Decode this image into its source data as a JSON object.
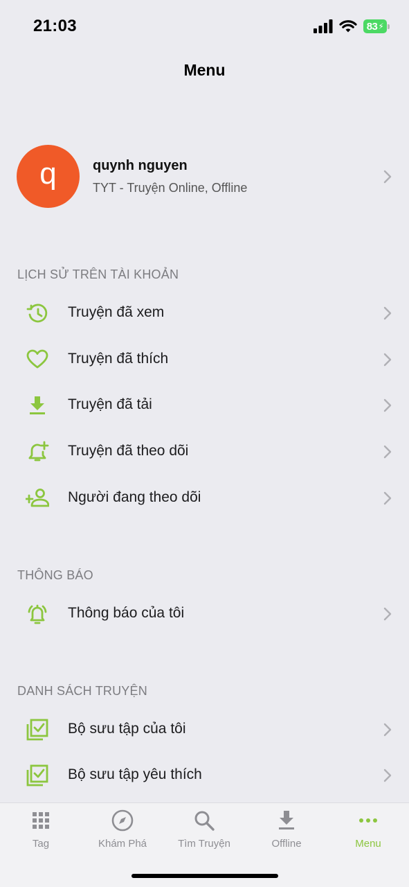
{
  "status_bar": {
    "time": "21:03",
    "battery": "83",
    "icons": [
      "cellular-signal-icon",
      "wifi-icon",
      "battery-charging-icon"
    ]
  },
  "nav": {
    "title": "Menu"
  },
  "profile": {
    "avatar_letter": "q",
    "avatar_color": "#f05a28",
    "name": "quynh nguyen",
    "subtitle": "TYT - Truyện Online, Offline"
  },
  "sections": {
    "history": {
      "header": "LỊCH SỬ TRÊN TÀI KHOẢN",
      "items": [
        {
          "label": "Truyện đã xem",
          "icon": "history-icon"
        },
        {
          "label": "Truyện đã thích",
          "icon": "heart-icon"
        },
        {
          "label": "Truyện đã tải",
          "icon": "download-icon"
        },
        {
          "label": "Truyện đã theo dõi",
          "icon": "bell-plus-icon"
        },
        {
          "label": "Người đang theo dõi",
          "icon": "person-add-icon"
        }
      ]
    },
    "notifications": {
      "header": "THÔNG BÁO",
      "items": [
        {
          "label": "Thông báo của tôi",
          "icon": "bell-ringing-icon"
        }
      ]
    },
    "lists": {
      "header": "DANH SÁCH TRUYỆN",
      "items": [
        {
          "label": "Bộ sưu tập của tôi",
          "icon": "collection-check-icon"
        },
        {
          "label": "Bộ sưu tập yêu thích",
          "icon": "collection-check-icon"
        }
      ]
    }
  },
  "tab_bar": {
    "tabs": [
      {
        "label": "Tag",
        "icon": "grid-icon"
      },
      {
        "label": "Khám Phá",
        "icon": "compass-icon"
      },
      {
        "label": "Tìm Truyện",
        "icon": "search-icon"
      },
      {
        "label": "Offline",
        "icon": "download-icon"
      },
      {
        "label": "Menu",
        "icon": "more-dots-icon"
      }
    ],
    "active": "Menu"
  },
  "colors": {
    "accent": "#8cc63f",
    "background": "#ebebf0",
    "inactive": "#8e8e93"
  }
}
